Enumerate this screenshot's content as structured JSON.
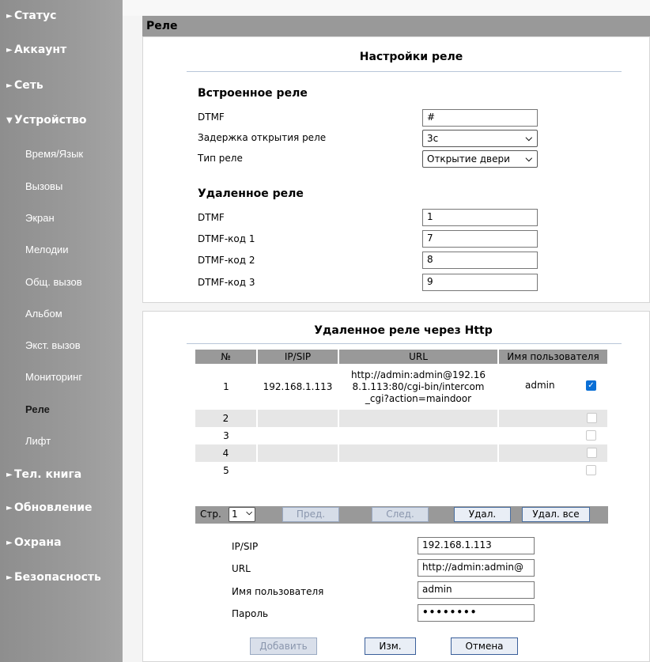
{
  "sidebar": {
    "items": [
      {
        "label": "Статус",
        "arrow": "►"
      },
      {
        "label": "Аккаунт",
        "arrow": "►"
      },
      {
        "label": "Сеть",
        "arrow": "►"
      },
      {
        "label": "Устройство",
        "arrow": "▼"
      },
      {
        "label": "Тел. книга",
        "arrow": "►"
      },
      {
        "label": "Обновление",
        "arrow": "►"
      },
      {
        "label": "Охрана",
        "arrow": "►"
      },
      {
        "label": "Безопасность",
        "arrow": "►"
      }
    ],
    "subitems": [
      "Время/Язык",
      "Вызовы",
      "Экран",
      "Мелодии",
      "Общ. вызов",
      "Альбом",
      "Экст. вызов",
      "Мониторинг",
      "Реле",
      "Лифт"
    ],
    "active_subitem": "Реле"
  },
  "page": {
    "title": "Реле"
  },
  "relay_settings": {
    "title": "Настройки реле",
    "builtin": {
      "heading": "Встроенное реле",
      "dtmf_label": "DTMF",
      "dtmf_value": "#",
      "delay_label": "Задержка открытия реле",
      "delay_value": "3с",
      "type_label": "Тип реле",
      "type_value": "Открытие двери"
    },
    "remote": {
      "heading": "Удаленное реле",
      "dtmf_label": "DTMF",
      "dtmf_value": "1",
      "code1_label": "DTMF-код 1",
      "code1_value": "7",
      "code2_label": "DTMF-код 2",
      "code2_value": "8",
      "code3_label": "DTMF-код 3",
      "code3_value": "9"
    }
  },
  "http_relay": {
    "title": "Удаленное реле через Http",
    "columns": [
      "№",
      "IP/SIP",
      "URL",
      "Имя пользователя"
    ],
    "rows": [
      {
        "num": "1",
        "ip": "192.168.1.113",
        "url": "http://admin:admin@192.168.1.113:80/cgi-bin/intercom_cgi?action=maindoor",
        "user": "admin",
        "checked": true
      },
      {
        "num": "2",
        "ip": "",
        "url": "",
        "user": "",
        "checked": false
      },
      {
        "num": "3",
        "ip": "",
        "url": "",
        "user": "",
        "checked": false
      },
      {
        "num": "4",
        "ip": "",
        "url": "",
        "user": "",
        "checked": false
      },
      {
        "num": "5",
        "ip": "",
        "url": "",
        "user": "",
        "checked": false
      }
    ],
    "pager": {
      "page_label": "Стр.",
      "page_value": "1",
      "prev": "Пред.",
      "next": "След.",
      "delete": "Удал.",
      "delete_all": "Удал. все"
    },
    "form": {
      "ip_label": "IP/SIP",
      "ip_value": "192.168.1.113",
      "url_label": "URL",
      "url_value": "http://admin:admin@",
      "user_label": "Имя пользователя",
      "user_value": "admin",
      "pass_label": "Пароль",
      "pass_value": "••••••••"
    },
    "buttons": {
      "add": "Добавить",
      "edit": "Изм.",
      "cancel": "Отмена"
    }
  },
  "colors": {
    "accent": "#0a6fd6",
    "header": "#999999",
    "sidebar": "#9a9a9a"
  }
}
